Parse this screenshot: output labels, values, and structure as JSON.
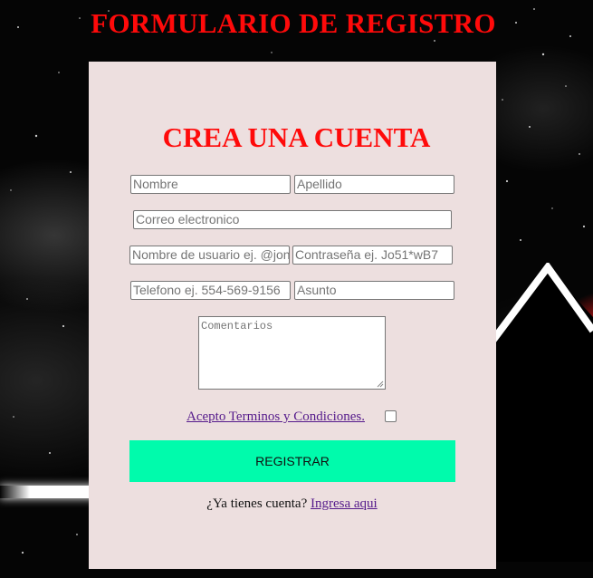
{
  "page": {
    "title": "FORMULARIO DE REGISTRO"
  },
  "form": {
    "heading": "CREA UNA CUENTA",
    "fields": {
      "nombre": "Nombre",
      "apellido": "Apellido",
      "correo": "Correo electronico",
      "usuario": "Nombre de usuario ej. @jonh",
      "contrasena": "Contraseña ej. Jo51*wB7",
      "telefono": "Telefono ej. 554-569-9156",
      "asunto": "Asunto",
      "comentarios": "Comentarios"
    },
    "terms_label": "Acepto Terminos y Condiciones.",
    "terms_checked": false,
    "submit_label": "REGISTRAR",
    "login_prompt": "¿Ya tienes cuenta?",
    "login_link": "Ingresa aqui"
  },
  "colors": {
    "title_red": "#ff0a0a",
    "card_bg": "#eddfdf",
    "button_green": "#00fbac",
    "link_purple": "#551a8b"
  }
}
